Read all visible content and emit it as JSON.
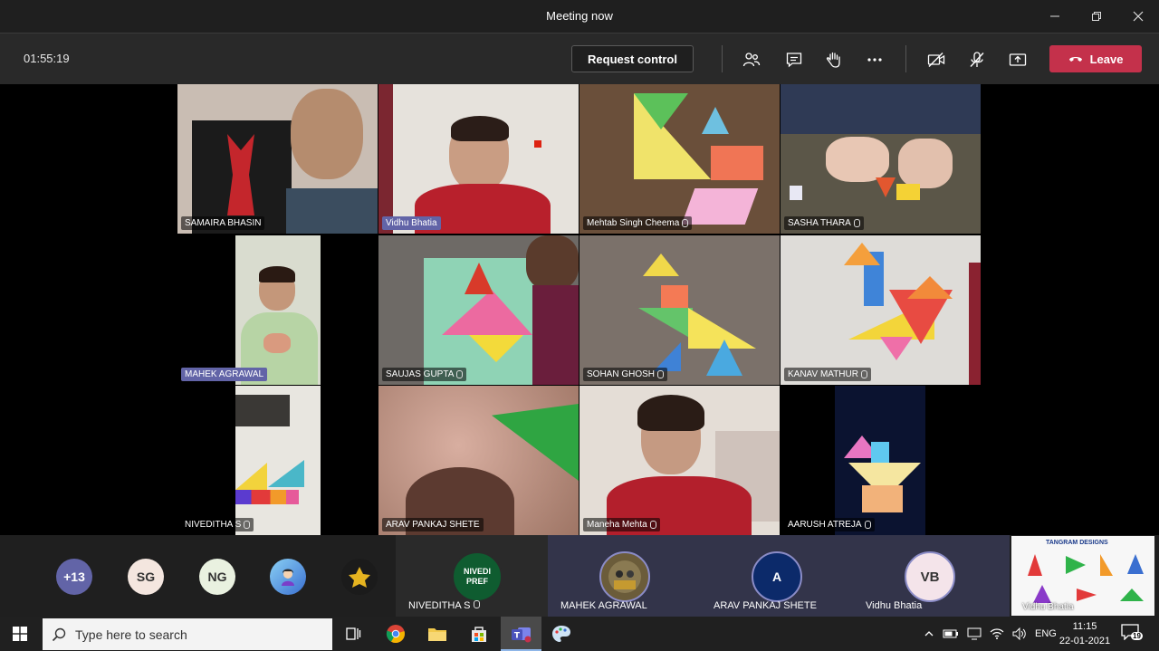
{
  "window": {
    "title": "Meeting now"
  },
  "toolbar": {
    "timer": "01:55:19",
    "request_control": "Request control",
    "leave": "Leave",
    "leave_color": "#c4314b"
  },
  "tiles": [
    {
      "name": "SAMAIRA BHASIN",
      "mic": false,
      "highlight": false
    },
    {
      "name": "Vidhu Bhatia",
      "mic": false,
      "highlight": true
    },
    {
      "name": "Mehtab Singh Cheema",
      "mic": true,
      "highlight": false
    },
    {
      "name": "SASHA THARA",
      "mic": true,
      "highlight": false
    },
    {
      "name": "MAHEK AGRAWAL",
      "mic": false,
      "highlight": true
    },
    {
      "name": "SAUJAS GUPTA",
      "mic": true,
      "highlight": false
    },
    {
      "name": "SOHAN GHOSH",
      "mic": true,
      "highlight": false
    },
    {
      "name": "KANAV MATHUR",
      "mic": true,
      "highlight": false
    },
    {
      "name": "NIVEDITHA S",
      "mic": true,
      "highlight": false
    },
    {
      "name": "ARAV PANKAJ SHETE",
      "mic": false,
      "highlight": false
    },
    {
      "name": "Maneha Mehta",
      "mic": true,
      "highlight": false
    },
    {
      "name": "AARUSH ATREJA",
      "mic": true,
      "highlight": false
    }
  ],
  "overflow": {
    "more_count": "+13",
    "avatars": [
      {
        "initials": "SG",
        "bg": "#f4e6df",
        "fg": "#333"
      },
      {
        "initials": "NG",
        "bg": "#e9f1e0",
        "fg": "#333"
      }
    ]
  },
  "strip_participants": [
    {
      "name": "NIVEDITHA S",
      "avatar_text": "NIVEDI PREF"
    },
    {
      "name": "MAHEK AGRAWAL"
    },
    {
      "name": "ARAV PANKAJ SHETE",
      "avatar_text": "A"
    },
    {
      "name": "Vidhu Bhatia",
      "avatar_text": "VB"
    }
  ],
  "share": {
    "heading": "TANGRAM DESIGNS",
    "presenter": "Vidhu Bhatia"
  },
  "taskbar": {
    "search_placeholder": "Type here to search",
    "language": "ENG",
    "time": "11:15",
    "date": "22-01-2021",
    "notifications": "19"
  }
}
